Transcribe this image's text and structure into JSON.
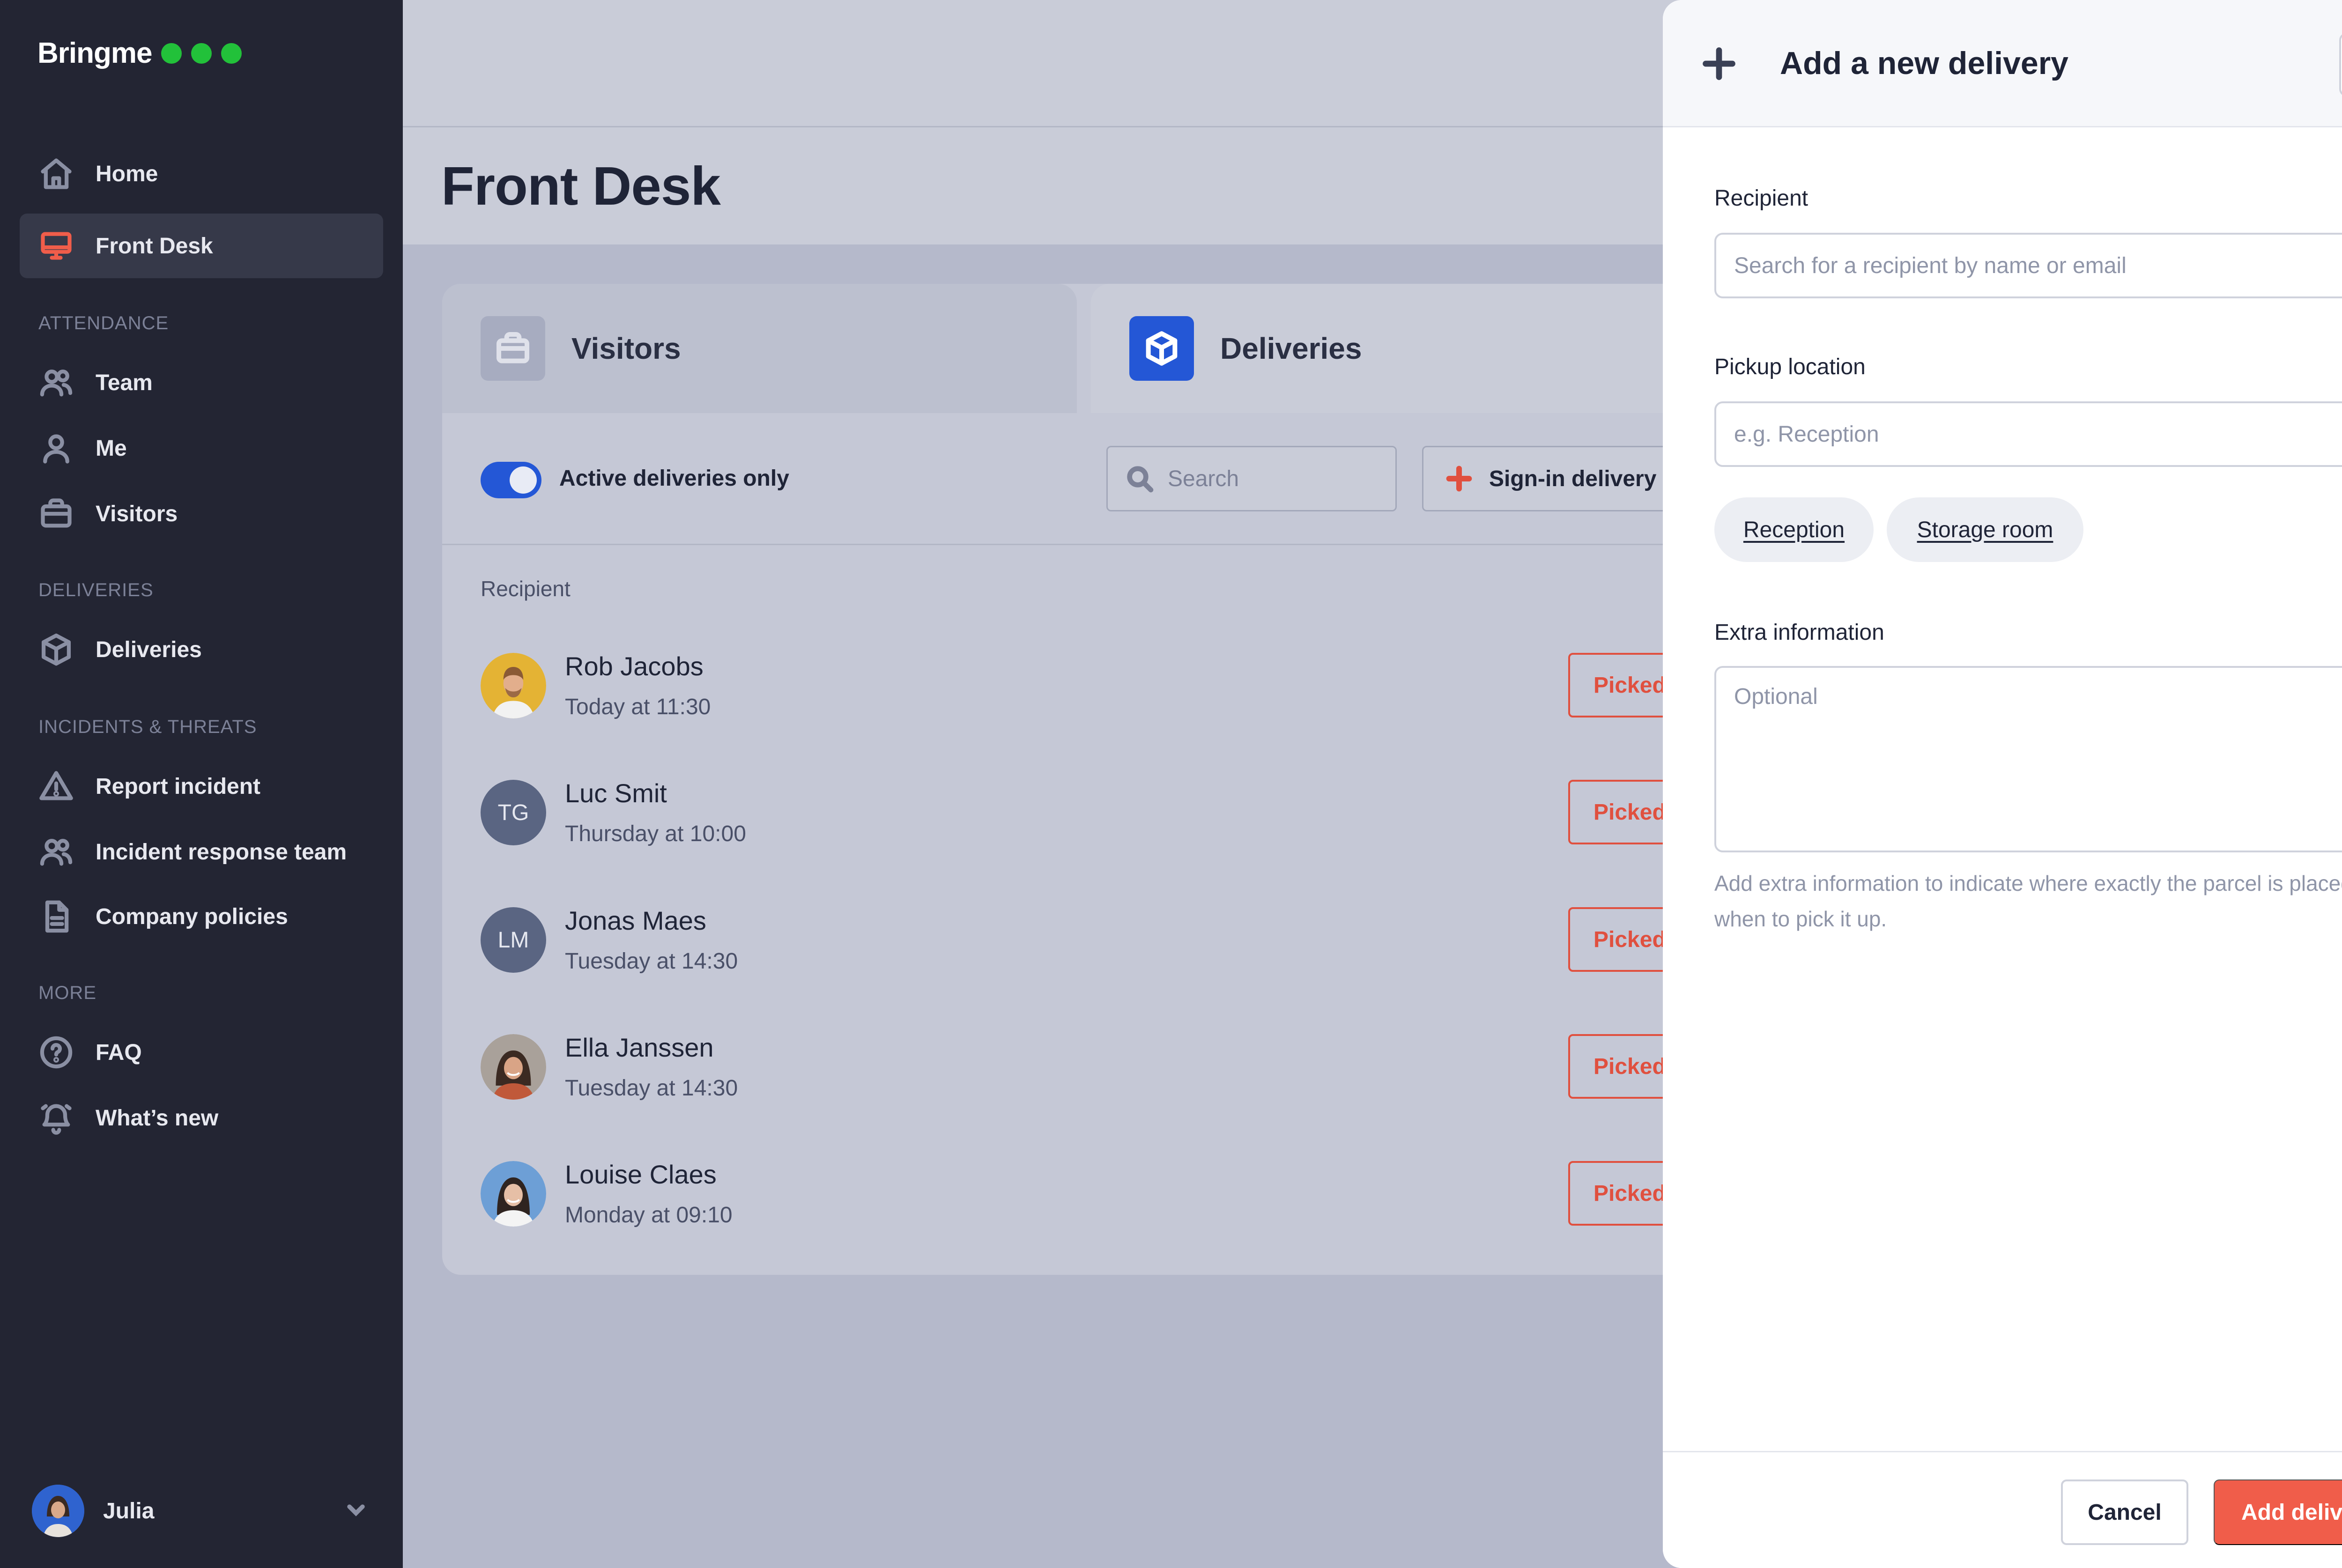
{
  "app": {
    "brand": "Bringme"
  },
  "sidebar": {
    "items": {
      "home": "Home",
      "front_desk": "Front Desk",
      "team": "Team",
      "me": "Me",
      "visitors": "Visitors",
      "deliveries": "Deliveries",
      "report_incident": "Report incident",
      "incident_response_team": "Incident response team",
      "company_policies": "Company policies",
      "faq": "FAQ",
      "whats_new": "What’s new"
    },
    "sections": {
      "attendance": "ATTENDANCE",
      "deliveries": "DELIVERIES",
      "incidents": "INCIDENTS & THREATS",
      "more": "MORE"
    },
    "active_item": "front_desk",
    "user": {
      "name": "Julia"
    }
  },
  "page": {
    "title": "Front Desk"
  },
  "front_desk": {
    "tabs": {
      "visitors": "Visitors",
      "deliveries": "Deliveries"
    },
    "active_tab": "deliveries",
    "toggle": {
      "label": "Active deliveries only",
      "on": true
    },
    "search_placeholder": "Search",
    "signin_button": "Sign-in delivery",
    "column_header": "Recipient",
    "deliveries": [
      {
        "name": "Rob Jacobs",
        "time": "Today at 11:30",
        "status": "Picked up"
      },
      {
        "name": "Luc Smit",
        "time": "Thursday at 10:00",
        "status": "Picked up",
        "initials": "TG"
      },
      {
        "name": "Jonas Maes",
        "time": "Tuesday at 14:30",
        "status": "Picked up",
        "initials": "LM"
      },
      {
        "name": "Ella Janssen",
        "time": "Tuesday at 14:30",
        "status": "Picked up"
      },
      {
        "name": "Louise Claes",
        "time": "Monday at 09:10",
        "status": "Picked up"
      }
    ]
  },
  "drawer": {
    "title": "Add a new delivery",
    "recipient": {
      "label": "Recipient",
      "placeholder": "Search for a recipient by name or email",
      "value": ""
    },
    "pickup": {
      "label": "Pickup location",
      "placeholder": "e.g. Reception",
      "value": "",
      "suggestions": [
        "Reception",
        "Storage room"
      ]
    },
    "extra": {
      "label": "Extra information",
      "placeholder": "Optional",
      "value": "",
      "help": "Add extra information to indicate where exactly the parcel is placed or when to pick it up."
    },
    "cancel": "Cancel",
    "submit": "Add delivery"
  },
  "colors": {
    "accent": "#f05d4a",
    "primary_blue": "#2457d6",
    "brand_dot": "#22c13a",
    "sidebar_bg": "#232533"
  }
}
